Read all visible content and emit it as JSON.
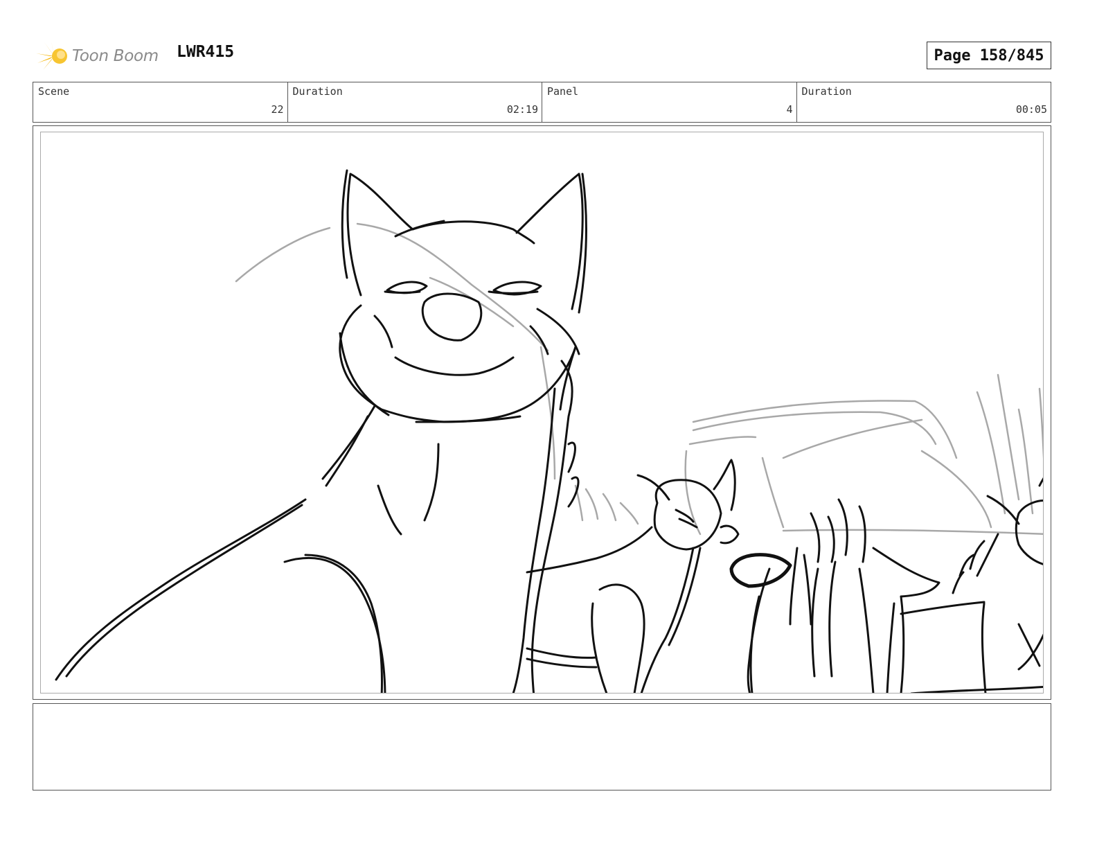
{
  "header": {
    "logo_text": "Toon Boom",
    "project_code": "LWR415",
    "page_label": "Page 158/845"
  },
  "info": {
    "scene_label": "Scene",
    "scene_value": "22",
    "scene_duration_label": "Duration",
    "scene_duration_value": "02:19",
    "panel_label": "Panel",
    "panel_value": "4",
    "panel_duration_label": "Duration",
    "panel_duration_value": "00:05"
  },
  "panel": {
    "image_icon": "sketch-drawing"
  },
  "notes": {
    "text": ""
  },
  "colors": {
    "logo_accent": "#f5b300",
    "logo_text": "#8a8a8a",
    "sketch_line": "#111111",
    "sketch_rough": "#a8a8a8",
    "frame_border": "#555555"
  }
}
